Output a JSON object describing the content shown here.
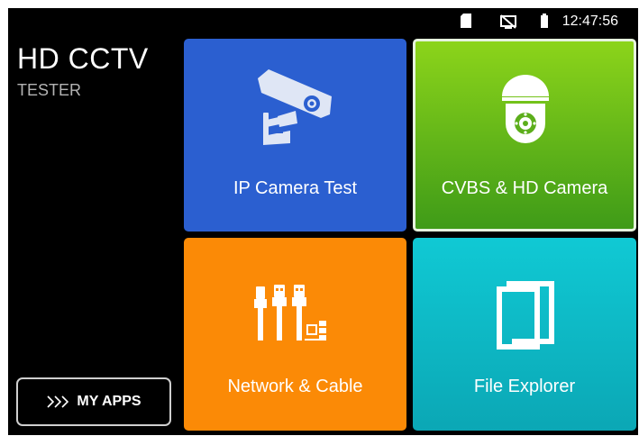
{
  "status_bar": {
    "time": "12:47:56",
    "icons": [
      "sd-card-icon",
      "no-screen-cast-icon",
      "battery-icon"
    ]
  },
  "brand": {
    "title": "HD CCTV",
    "subtitle": "TESTER"
  },
  "my_apps": {
    "label": "MY APPS",
    "icon": "triple-chevron-right-icon"
  },
  "tiles": [
    {
      "label": "IP Camera Test",
      "icon": "ip-camera-icon",
      "color": "#2b5fd0"
    },
    {
      "label": "CVBS & HD Camera",
      "icon": "dome-camera-icon",
      "color": "#5db51a"
    },
    {
      "label": "Network & Cable",
      "icon": "network-cable-icon",
      "color": "#fb8a06"
    },
    {
      "label": "File Explorer",
      "icon": "book-icon",
      "color": "#0fbcc8"
    }
  ]
}
